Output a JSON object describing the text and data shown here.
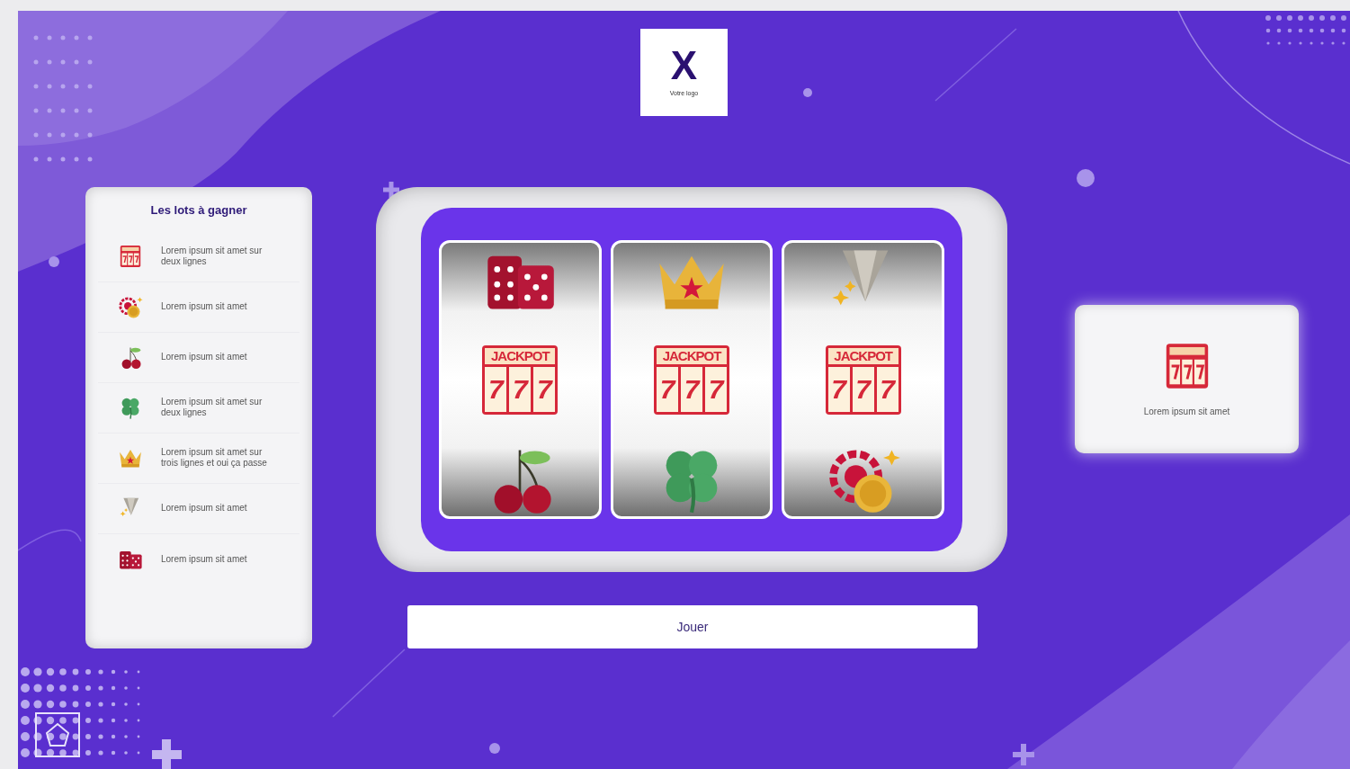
{
  "logo": {
    "mark": "X",
    "caption": "Votre logo"
  },
  "prizes": {
    "title": "Les lots à gagner",
    "items": [
      {
        "kind": "jackpot",
        "text": "Lorem ipsum sit amet sur deux lignes"
      },
      {
        "kind": "chip",
        "text": "Lorem ipsum sit amet"
      },
      {
        "kind": "cherry",
        "text": "Lorem ipsum sit amet"
      },
      {
        "kind": "clover",
        "text": "Lorem ipsum sit amet sur deux lignes"
      },
      {
        "kind": "crown",
        "text": "Lorem ipsum sit amet sur trois lignes et oui ça passe"
      },
      {
        "kind": "diamond",
        "text": "Lorem ipsum sit amet"
      },
      {
        "kind": "dice",
        "text": "Lorem ipsum sit amet"
      }
    ]
  },
  "reels": [
    {
      "symbols": [
        {
          "kind": "dice"
        },
        {
          "kind": "jackpot",
          "label": "JACKPOT",
          "digits": [
            "7",
            "7",
            "7"
          ]
        },
        {
          "kind": "cherry"
        }
      ]
    },
    {
      "symbols": [
        {
          "kind": "crown"
        },
        {
          "kind": "jackpot",
          "label": "JACKPOT",
          "digits": [
            "7",
            "7",
            "7"
          ]
        },
        {
          "kind": "clover"
        }
      ]
    },
    {
      "symbols": [
        {
          "kind": "diamond"
        },
        {
          "kind": "jackpot",
          "label": "JACKPOT",
          "digits": [
            "7",
            "7",
            "7"
          ]
        },
        {
          "kind": "chip"
        }
      ]
    }
  ],
  "play_button": "Jouer",
  "result": {
    "kind": "jackpot",
    "text": "Lorem ipsum sit amet"
  }
}
